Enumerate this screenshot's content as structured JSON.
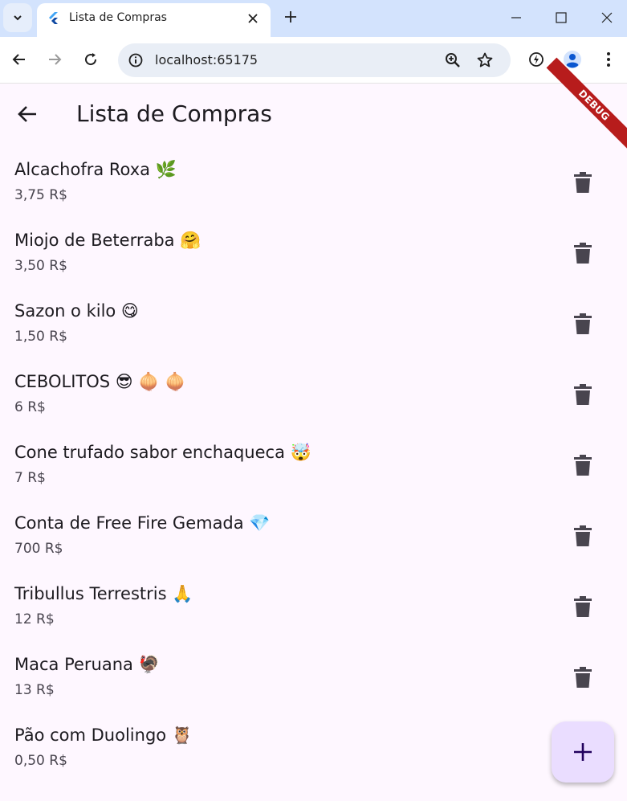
{
  "browser": {
    "tab_title": "Lista de Compras",
    "url": "localhost:65175",
    "icons": {
      "tab_search": "chevron-down-icon",
      "tab_close": "close-icon",
      "new_tab": "plus-icon",
      "minimize": "minimize-icon",
      "maximize": "maximize-icon",
      "close_window": "close-icon",
      "back": "arrow-left-icon",
      "forward": "arrow-right-icon",
      "reload": "reload-icon",
      "site_info": "info-icon",
      "zoom": "zoom-icon",
      "bookmark": "star-icon",
      "extension": "lightning-icon",
      "profile": "avatar-icon",
      "menu": "kebab-menu-icon"
    }
  },
  "app": {
    "title": "Lista de Compras",
    "debug_banner": "DEBUG",
    "colors": {
      "background": "#fef7ff",
      "fab": "#eaddff",
      "fab_icon": "#21005d",
      "delete_icon": "#49454f",
      "banner": "#b71c1c"
    },
    "items": [
      {
        "name": "Alcachofra Roxa 🌿",
        "price": "3,75 R$"
      },
      {
        "name": "Miojo de Beterraba 🤗",
        "price": "3,50 R$"
      },
      {
        "name": "Sazon o kilo 😋",
        "price": "1,50 R$"
      },
      {
        "name": "CEBOLITOS 😎 🧅 🧅",
        "price": "6 R$"
      },
      {
        "name": "Cone trufado sabor enchaqueca 🤯",
        "price": "7 R$"
      },
      {
        "name": "Conta de Free Fire Gemada 💎",
        "price": "700 R$"
      },
      {
        "name": "Tribullus Terrestris 🙏",
        "price": "12 R$"
      },
      {
        "name": "Maca Peruana 🦃",
        "price": "13 R$"
      },
      {
        "name": "Pão com Duolingo 🦉",
        "price": "0,50 R$"
      }
    ],
    "fab_icon": "plus-icon",
    "delete_icon": "trash-icon"
  }
}
